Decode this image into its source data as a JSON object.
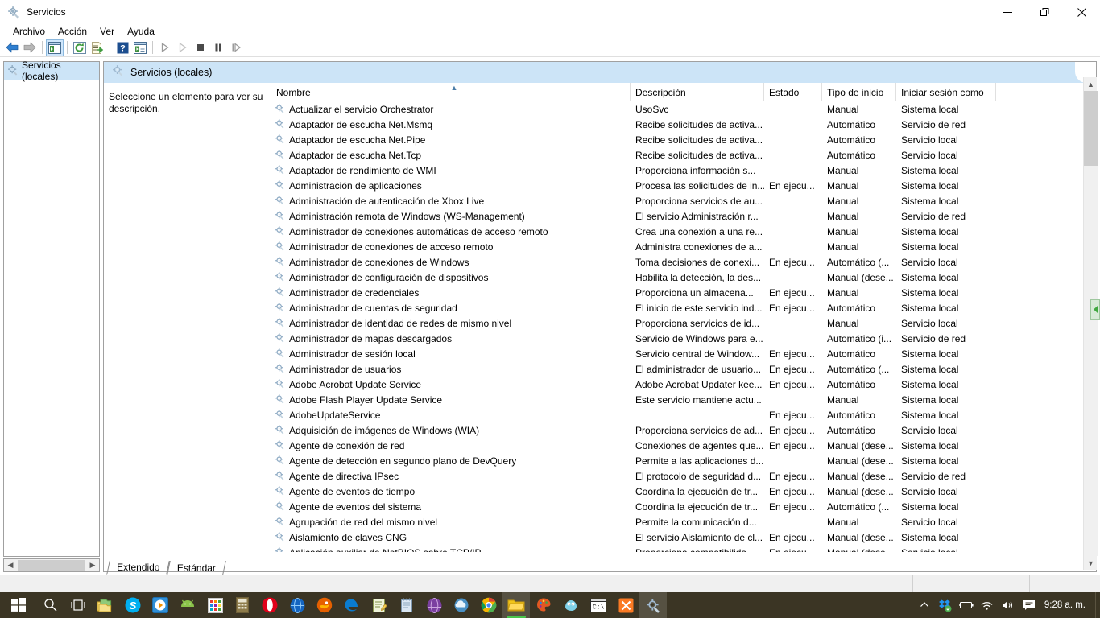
{
  "window": {
    "title": "Servicios",
    "icon": "services-gear-icon",
    "controls": {
      "minimize": "—",
      "maximize": "❐",
      "close": "✕"
    }
  },
  "menu": {
    "items": [
      "Archivo",
      "Acción",
      "Ver",
      "Ayuda"
    ]
  },
  "toolbar": {
    "buttons": [
      {
        "name": "back-button",
        "icon": "arrow-left-icon"
      },
      {
        "name": "forward-button",
        "icon": "arrow-right-icon"
      },
      {
        "name": "show-hide-tree-button",
        "icon": "console-tree-icon"
      },
      {
        "name": "refresh-button",
        "icon": "refresh-icon"
      },
      {
        "name": "export-list-button",
        "icon": "export-list-icon"
      },
      {
        "name": "help-button",
        "icon": "help-icon"
      },
      {
        "name": "properties-button",
        "icon": "properties-icon"
      },
      {
        "name": "start-service-button",
        "icon": "play-icon"
      },
      {
        "name": "resume-service-button",
        "icon": "play-outline-icon"
      },
      {
        "name": "stop-service-button",
        "icon": "stop-icon"
      },
      {
        "name": "pause-service-button",
        "icon": "pause-icon"
      },
      {
        "name": "restart-service-button",
        "icon": "restart-icon"
      }
    ]
  },
  "tree": {
    "root_label": "Servicios (locales)"
  },
  "pane": {
    "header_title": "Servicios (locales)",
    "description_placeholder": "Seleccione un elemento para ver su descripción."
  },
  "list": {
    "columns": [
      {
        "key": "name",
        "label": "Nombre",
        "sorted": true,
        "sort_dir": "asc"
      },
      {
        "key": "desc",
        "label": "Descripción"
      },
      {
        "key": "estado",
        "label": "Estado"
      },
      {
        "key": "tipo",
        "label": "Tipo de inicio"
      },
      {
        "key": "login",
        "label": "Iniciar sesión como"
      }
    ],
    "rows": [
      {
        "name": "Actualizar el servicio Orchestrator",
        "desc": "UsoSvc",
        "estado": "",
        "tipo": "Manual",
        "login": "Sistema local"
      },
      {
        "name": "Adaptador de escucha Net.Msmq",
        "desc": "Recibe solicitudes de activa...",
        "estado": "",
        "tipo": "Automático",
        "login": "Servicio de red"
      },
      {
        "name": "Adaptador de escucha Net.Pipe",
        "desc": "Recibe solicitudes de activa...",
        "estado": "",
        "tipo": "Automático",
        "login": "Servicio local"
      },
      {
        "name": "Adaptador de escucha Net.Tcp",
        "desc": "Recibe solicitudes de activa...",
        "estado": "",
        "tipo": "Automático",
        "login": "Servicio local"
      },
      {
        "name": "Adaptador de rendimiento de WMI",
        "desc": "Proporciona información s...",
        "estado": "",
        "tipo": "Manual",
        "login": "Sistema local"
      },
      {
        "name": "Administración de aplicaciones",
        "desc": "Procesa las solicitudes de in...",
        "estado": "En ejecu...",
        "tipo": "Manual",
        "login": "Sistema local"
      },
      {
        "name": "Administración de autenticación de Xbox Live",
        "desc": "Proporciona servicios de au...",
        "estado": "",
        "tipo": "Manual",
        "login": "Sistema local"
      },
      {
        "name": "Administración remota de Windows (WS-Management)",
        "desc": "El servicio Administración r...",
        "estado": "",
        "tipo": "Manual",
        "login": "Servicio de red"
      },
      {
        "name": "Administrador de conexiones automáticas de acceso remoto",
        "desc": "Crea una conexión a una re...",
        "estado": "",
        "tipo": "Manual",
        "login": "Sistema local"
      },
      {
        "name": "Administrador de conexiones de acceso remoto",
        "desc": "Administra conexiones de a...",
        "estado": "",
        "tipo": "Manual",
        "login": "Sistema local"
      },
      {
        "name": "Administrador de conexiones de Windows",
        "desc": "Toma decisiones de conexi...",
        "estado": "En ejecu...",
        "tipo": "Automático (...",
        "login": "Servicio local"
      },
      {
        "name": "Administrador de configuración de dispositivos",
        "desc": "Habilita la detección, la des...",
        "estado": "",
        "tipo": "Manual (dese...",
        "login": "Sistema local"
      },
      {
        "name": "Administrador de credenciales",
        "desc": "Proporciona un almacena...",
        "estado": "En ejecu...",
        "tipo": "Manual",
        "login": "Sistema local"
      },
      {
        "name": "Administrador de cuentas de seguridad",
        "desc": "El inicio de este servicio ind...",
        "estado": "En ejecu...",
        "tipo": "Automático",
        "login": "Sistema local"
      },
      {
        "name": "Administrador de identidad de redes de mismo nivel",
        "desc": "Proporciona servicios de id...",
        "estado": "",
        "tipo": "Manual",
        "login": "Servicio local"
      },
      {
        "name": "Administrador de mapas descargados",
        "desc": "Servicio de Windows para e...",
        "estado": "",
        "tipo": "Automático (i...",
        "login": "Servicio de red"
      },
      {
        "name": "Administrador de sesión local",
        "desc": "Servicio central de Window...",
        "estado": "En ejecu...",
        "tipo": "Automático",
        "login": "Sistema local"
      },
      {
        "name": "Administrador de usuarios",
        "desc": "El administrador de usuario...",
        "estado": "En ejecu...",
        "tipo": "Automático (...",
        "login": "Sistema local"
      },
      {
        "name": "Adobe Acrobat Update Service",
        "desc": "Adobe Acrobat Updater kee...",
        "estado": "En ejecu...",
        "tipo": "Automático",
        "login": "Sistema local"
      },
      {
        "name": "Adobe Flash Player Update Service",
        "desc": "Este servicio mantiene actu...",
        "estado": "",
        "tipo": "Manual",
        "login": "Sistema local"
      },
      {
        "name": "AdobeUpdateService",
        "desc": "",
        "estado": "En ejecu...",
        "tipo": "Automático",
        "login": "Sistema local"
      },
      {
        "name": "Adquisición de imágenes de Windows (WIA)",
        "desc": "Proporciona servicios de ad...",
        "estado": "En ejecu...",
        "tipo": "Automático",
        "login": "Servicio local"
      },
      {
        "name": "Agente de conexión de red",
        "desc": "Conexiones de agentes que...",
        "estado": "En ejecu...",
        "tipo": "Manual (dese...",
        "login": "Sistema local"
      },
      {
        "name": "Agente de detección en segundo plano de DevQuery",
        "desc": "Permite a las aplicaciones d...",
        "estado": "",
        "tipo": "Manual (dese...",
        "login": "Sistema local"
      },
      {
        "name": "Agente de directiva IPsec",
        "desc": "El protocolo de seguridad d...",
        "estado": "En ejecu...",
        "tipo": "Manual (dese...",
        "login": "Servicio de red"
      },
      {
        "name": "Agente de eventos de tiempo",
        "desc": "Coordina la ejecución de tr...",
        "estado": "En ejecu...",
        "tipo": "Manual (dese...",
        "login": "Servicio local"
      },
      {
        "name": "Agente de eventos del sistema",
        "desc": "Coordina la ejecución de tr...",
        "estado": "En ejecu...",
        "tipo": "Automático (...",
        "login": "Sistema local"
      },
      {
        "name": "Agrupación de red del mismo nivel",
        "desc": "Permite la comunicación d...",
        "estado": "",
        "tipo": "Manual",
        "login": "Servicio local"
      },
      {
        "name": "Aislamiento de claves CNG",
        "desc": "El servicio Aislamiento de cl...",
        "estado": "En ejecu...",
        "tipo": "Manual (dese...",
        "login": "Sistema local"
      },
      {
        "name": "Aplicación auxiliar de NetBIOS sobre TCP/IP",
        "desc": "Proporciona compatibilida...",
        "estado": "En ejecu...",
        "tipo": "Manual (dese...",
        "login": "Servicio local"
      }
    ]
  },
  "tabs": [
    {
      "label": "Extendido",
      "active": true
    },
    {
      "label": "Estándar",
      "active": false
    }
  ],
  "taskbar": {
    "start": {
      "name": "start-button",
      "icon": "windows-logo-icon"
    },
    "search": {
      "name": "search-button",
      "icon": "search-icon"
    },
    "taskview": {
      "name": "task-view-button",
      "icon": "task-view-icon"
    },
    "apps": [
      {
        "name": "file-explorer-pinned",
        "icon": "folder-stack-icon",
        "color": "#f0c419"
      },
      {
        "name": "skype-app",
        "icon": "skype-icon",
        "color": "#00aff0"
      },
      {
        "name": "media-player-app",
        "icon": "play-circle-icon",
        "color": "#2196f3"
      },
      {
        "name": "android-studio-app",
        "icon": "android-icon",
        "color": "#7cb342"
      },
      {
        "name": "app-grid",
        "icon": "grid-icon",
        "color": "#ffffff"
      },
      {
        "name": "calculator-app",
        "icon": "calculator-icon",
        "color": "#8d7b4a"
      },
      {
        "name": "opera-browser",
        "icon": "opera-icon",
        "color": "#e0001a"
      },
      {
        "name": "blue-globe-app",
        "icon": "globe-icon",
        "color": "#1565c0"
      },
      {
        "name": "firefox-browser",
        "icon": "firefox-icon",
        "color": "#e66000"
      },
      {
        "name": "edge-legacy-app",
        "icon": "edge-icon",
        "color": "#0078d7"
      },
      {
        "name": "edge-browser",
        "icon": "edge-icon",
        "color": "#0078d7"
      },
      {
        "name": "notes-app",
        "icon": "notepad-pencil-icon",
        "color": "#dfe8c0"
      },
      {
        "name": "notepad-app",
        "icon": "notepad-icon",
        "color": "#cfe0ef"
      },
      {
        "name": "purple-sphere-app",
        "icon": "sphere-icon",
        "color": "#7b3fa0"
      },
      {
        "name": "cloud-app",
        "icon": "cloud-icon",
        "color": "#4a90c4"
      },
      {
        "name": "chrome-browser",
        "icon": "chrome-icon",
        "color": "#4caf50"
      },
      {
        "name": "file-explorer-active",
        "icon": "folder-icon",
        "color": "#f0c419"
      },
      {
        "name": "paint-app",
        "icon": "paint-palette-icon",
        "color": "#e25822"
      },
      {
        "name": "gimp-app",
        "icon": "gimp-icon",
        "color": "#5bc0de"
      },
      {
        "name": "command-prompt",
        "icon": "terminal-icon",
        "color": "#ffffff"
      },
      {
        "name": "xampp-app",
        "icon": "xampp-icon",
        "color": "#fb7a24"
      },
      {
        "name": "services-app-active",
        "icon": "services-gear-icon",
        "color": "#9fb8cf"
      }
    ],
    "tray": {
      "chevron": {
        "name": "show-hidden-icons-button",
        "icon": "chevron-up-icon"
      },
      "icons": [
        {
          "name": "dropbox-tray-icon",
          "icon": "dropbox-icon"
        },
        {
          "name": "battery-tray-icon",
          "icon": "battery-icon"
        },
        {
          "name": "network-tray-icon",
          "icon": "wifi-icon"
        },
        {
          "name": "volume-tray-icon",
          "icon": "speaker-icon"
        },
        {
          "name": "action-center-icon",
          "icon": "notification-icon"
        }
      ],
      "clock": "9:28 a. m."
    }
  }
}
